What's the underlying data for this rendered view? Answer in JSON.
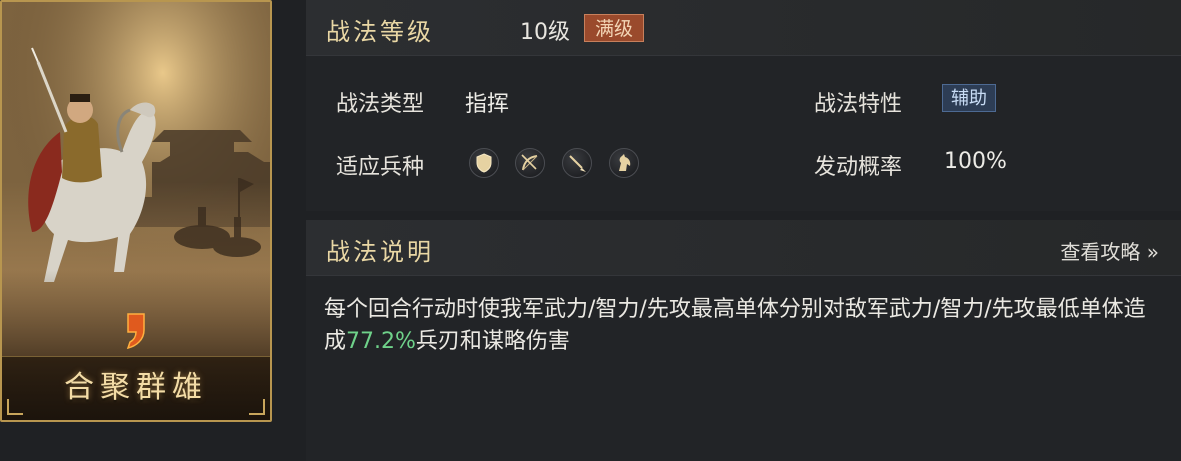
{
  "card": {
    "name": "合聚群雄",
    "badge_icon": "rank-badge-icon",
    "colors": {
      "border": "#b8964f",
      "name": "#f3dca6"
    }
  },
  "level": {
    "title": "战法等级",
    "value": "10级",
    "badge": "满级"
  },
  "info": {
    "type_label": "战法类型",
    "type_value": "指挥",
    "trait_label": "战法特性",
    "trait_badge": "辅助",
    "troops_label": "适应兵种",
    "troop_icons": [
      "shield-icon",
      "bow-icon",
      "spear-icon",
      "horse-icon"
    ],
    "rate_label": "发动概率",
    "rate_value": "100%"
  },
  "description": {
    "title": "战法说明",
    "guide_link": "查看攻略 »",
    "text_before": "每个回合行动时使我军武力/智力/先攻最高单体分别对敌军武力/智力/先攻最低单体造成",
    "highlight": "77.2%",
    "text_after": "兵刃和谋略伤害",
    "colors": {
      "highlight": "#6fd28a"
    }
  }
}
